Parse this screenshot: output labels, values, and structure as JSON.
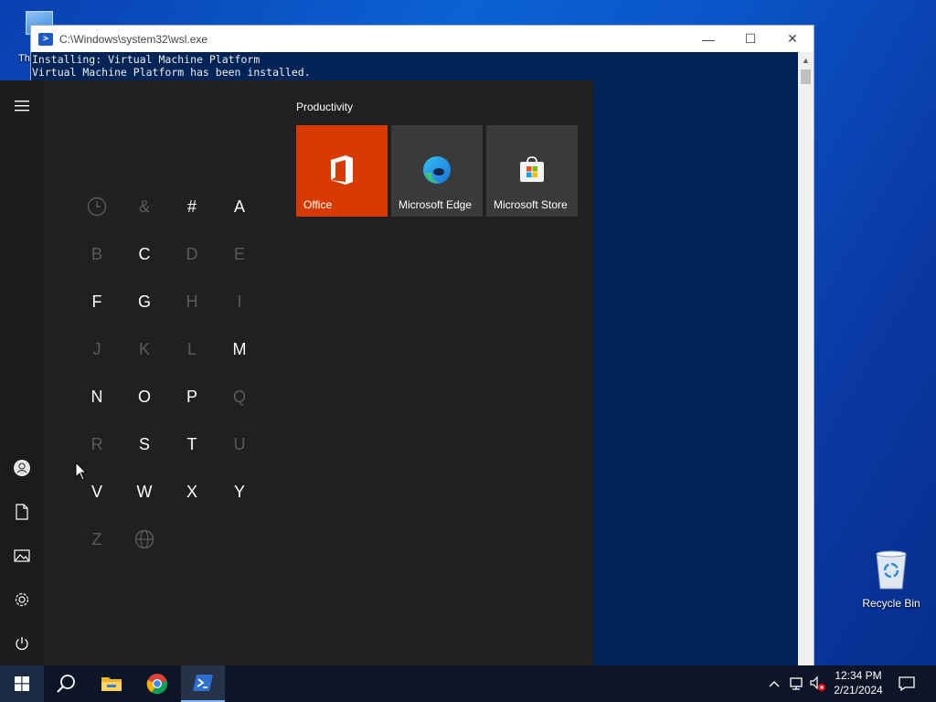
{
  "desktop": {
    "top_icon_label": "Th",
    "recycle_bin_label": "Recycle Bin"
  },
  "terminal": {
    "title": "C:\\Windows\\system32\\wsl.exe",
    "lines": [
      "Installing: Virtual Machine Platform",
      "Virtual Machine Platform has been installed."
    ],
    "controls": {
      "minimize": "—",
      "maximize": "☐",
      "close": "✕"
    }
  },
  "start_menu": {
    "menu_icon": "hamburger-icon",
    "rail": [
      {
        "name": "user-icon"
      },
      {
        "name": "documents-icon"
      },
      {
        "name": "pictures-icon"
      },
      {
        "name": "settings-icon"
      },
      {
        "name": "power-icon"
      }
    ],
    "alphabet": [
      {
        "label": "",
        "icon": "clock-icon",
        "enabled": false
      },
      {
        "label": "&",
        "enabled": false
      },
      {
        "label": "#",
        "enabled": true
      },
      {
        "label": "A",
        "enabled": true
      },
      {
        "label": "B",
        "enabled": false
      },
      {
        "label": "C",
        "enabled": true
      },
      {
        "label": "D",
        "enabled": false
      },
      {
        "label": "E",
        "enabled": false
      },
      {
        "label": "F",
        "enabled": true
      },
      {
        "label": "G",
        "enabled": true
      },
      {
        "label": "H",
        "enabled": false
      },
      {
        "label": "I",
        "enabled": false
      },
      {
        "label": "J",
        "enabled": false
      },
      {
        "label": "K",
        "enabled": false
      },
      {
        "label": "L",
        "enabled": false
      },
      {
        "label": "M",
        "enabled": true
      },
      {
        "label": "N",
        "enabled": true
      },
      {
        "label": "O",
        "enabled": true
      },
      {
        "label": "P",
        "enabled": true
      },
      {
        "label": "Q",
        "enabled": false
      },
      {
        "label": "R",
        "enabled": false
      },
      {
        "label": "S",
        "enabled": true
      },
      {
        "label": "T",
        "enabled": true
      },
      {
        "label": "U",
        "enabled": false
      },
      {
        "label": "V",
        "enabled": true
      },
      {
        "label": "W",
        "enabled": true
      },
      {
        "label": "X",
        "enabled": true
      },
      {
        "label": "Y",
        "enabled": true
      },
      {
        "label": "Z",
        "enabled": false
      },
      {
        "label": "",
        "icon": "globe-icon",
        "enabled": false
      }
    ],
    "group_title": "Productivity",
    "tiles": [
      {
        "label": "Office",
        "color": "#D83B01",
        "icon": "office-icon"
      },
      {
        "label": "Microsoft Edge",
        "color": "#3a3a3a",
        "icon": "edge-icon"
      },
      {
        "label": "Microsoft Store",
        "color": "#3a3a3a",
        "icon": "store-icon"
      }
    ]
  },
  "taskbar": {
    "apps": [
      {
        "name": "search-icon"
      },
      {
        "name": "file-explorer-icon"
      },
      {
        "name": "chrome-icon"
      },
      {
        "name": "powershell-icon"
      }
    ],
    "clock_time": "12:34 PM",
    "clock_date": "2/21/2024"
  },
  "colors": {
    "start_bg": "#202020",
    "office_tile": "#D83B01",
    "terminal_bg": "#012456",
    "taskbar_bg": "#0d1626"
  }
}
